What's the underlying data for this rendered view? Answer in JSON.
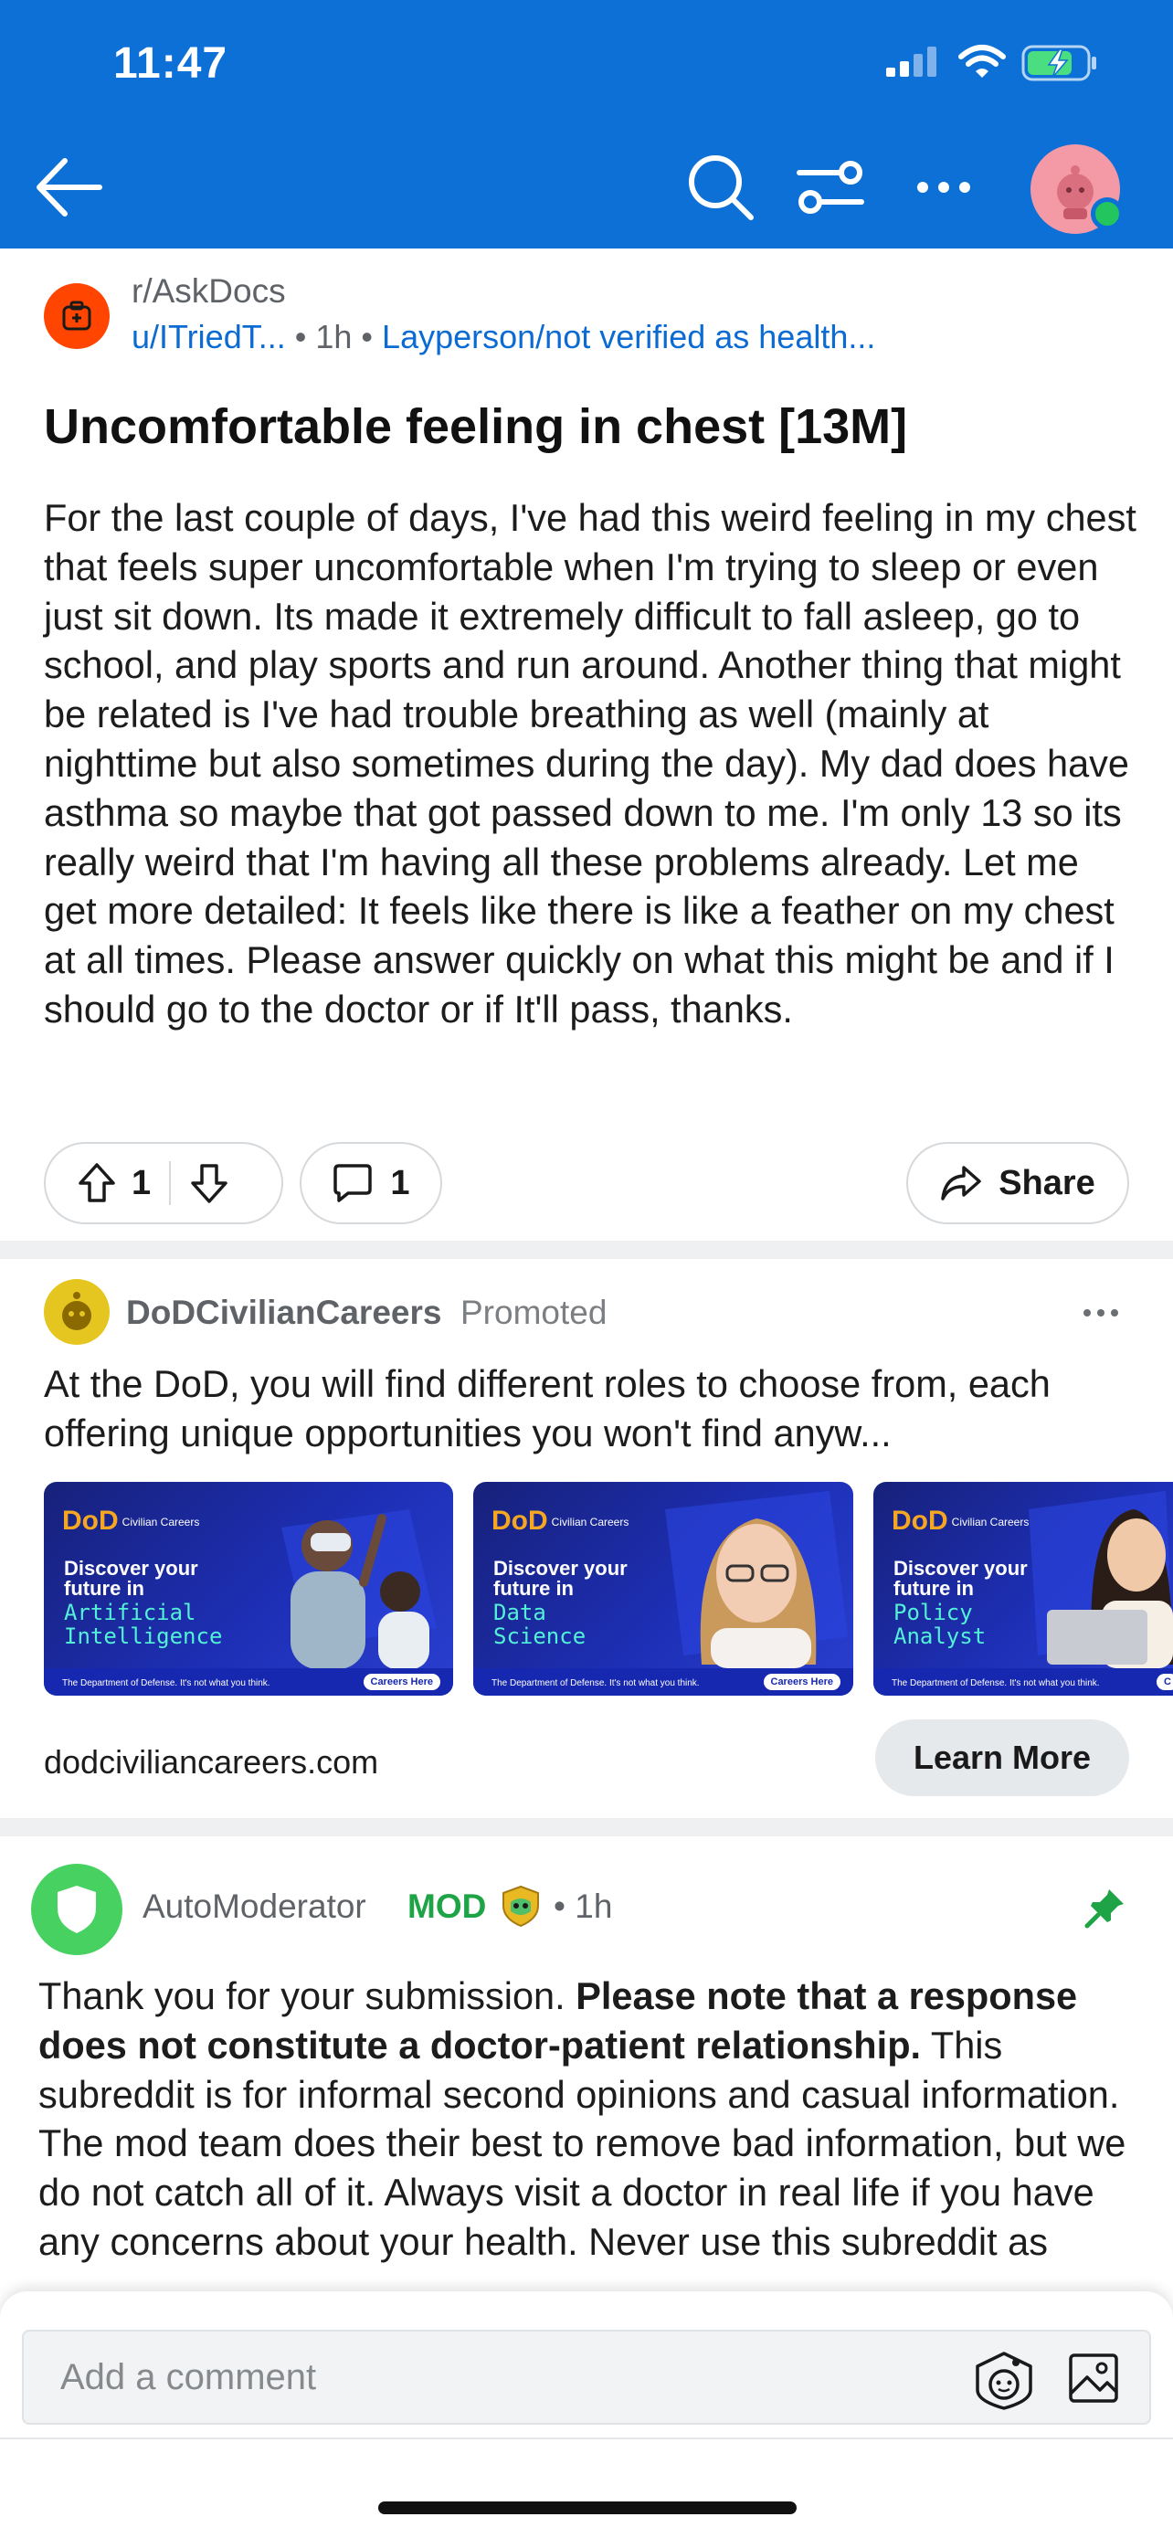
{
  "status_bar": {
    "time": "11:47"
  },
  "post": {
    "subreddit": "r/AskDocs",
    "author": "u/ITriedT...",
    "separator": "•",
    "time": "1h",
    "flair": "Layperson/not verified as health...",
    "title": "Uncomfortable feeling in chest [13M]",
    "body": "For the last couple of days, I've had this weird feeling in my chest that feels super uncomfortable when I'm trying to sleep or even just sit down. Its made it extremely difficult to fall asleep, go to school, and play sports and run around. Another thing that might be related is I've had trouble breathing as well (mainly at nighttime but also sometimes during the day). My dad does have asthma so maybe that got passed down to me. I'm only 13 so its really weird that I'm having all these problems already. Let me get more detailed: It feels like there is like a feather on my chest at all times. Please answer quickly on what this might be and if I should go to the doctor or if It'll pass, thanks.",
    "upvotes": "1",
    "comments": "1",
    "share_label": "Share"
  },
  "ad": {
    "advertiser": "DoDCivilianCareers",
    "promoted_label": "Promoted",
    "text": "At the DoD, you will find different roles to choose from, each offering unique opportunities you won't find anyw...",
    "cards": [
      {
        "logo": "DoD",
        "logo_sub": "Civilian Careers",
        "headline": "Discover your future in",
        "topic": "Artificial Intelligence",
        "tagline": "The Department of Defense. It's not what you think.",
        "cta": "Careers Here"
      },
      {
        "logo": "DoD",
        "logo_sub": "Civilian Careers",
        "headline": "Discover your future in",
        "topic": "Data Science",
        "tagline": "The Department of Defense. It's not what you think.",
        "cta": "Careers Here"
      },
      {
        "logo": "DoD",
        "logo_sub": "Civilian Careers",
        "headline": "Discover your future in",
        "topic": "Policy Analyst",
        "tagline": "The Department of Defense. It's not what you think.",
        "cta": "C"
      }
    ],
    "domain": "dodciviliancareers.com",
    "cta_label": "Learn More"
  },
  "comment": {
    "author": "AutoModerator",
    "mod_label": "MOD",
    "separator": "•",
    "time": "1h",
    "body_intro": "Thank you for your submission. ",
    "body_bold": "Please note that a response does not constitute a doctor-patient relationship.",
    "body_rest": " This subreddit is for informal second opinions and casual information. The mod team does their best to remove bad information, but we do not catch all of it. Always visit a doctor in real life if you have any concerns about your health. Never use this subreddit as"
  },
  "composer": {
    "placeholder": "Add a comment"
  },
  "colors": {
    "header": "#0c70d6",
    "link_blue": "#0b6bd3",
    "mod_green": "#1ea446",
    "subreddit_orange": "#ff4500"
  },
  "icons": [
    "back-arrow-icon",
    "search-icon",
    "filter-icon",
    "more-icon",
    "avatar-icon",
    "upvote-icon",
    "downvote-icon",
    "comment-icon",
    "share-icon",
    "pin-icon",
    "snoo-icon",
    "image-icon"
  ]
}
